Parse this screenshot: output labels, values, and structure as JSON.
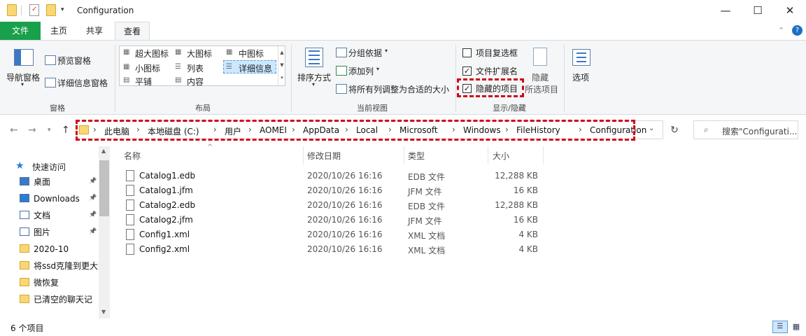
{
  "window": {
    "title": "Configuration",
    "minimize": "—",
    "maximize": "☐",
    "close": "✕"
  },
  "tabs": {
    "file": "文件",
    "home": "主页",
    "share": "共享",
    "view": "查看"
  },
  "ribbon": {
    "panes": {
      "label": "窗格",
      "nav_pane": "导航窗格",
      "preview_pane": "预览窗格",
      "details_pane": "详细信息窗格"
    },
    "layout": {
      "label": "布局",
      "xl_icons": "超大图标",
      "large_icons": "大图标",
      "medium_icons": "中图标",
      "small_icons": "小图标",
      "list": "列表",
      "details": "详细信息",
      "tiles": "平铺",
      "content": "内容"
    },
    "current_view": {
      "label": "当前视图",
      "sort_by": "排序方式",
      "group_by": "分组依据",
      "add_columns": "添加列",
      "fit_columns": "将所有列调整为合适的大小"
    },
    "show_hide": {
      "label": "显示/隐藏",
      "item_checkboxes": "项目复选框",
      "file_extensions": "文件扩展名",
      "hidden_items": "隐藏的项目",
      "hide_selected": "隐藏",
      "hide_selected_2": "所选项目",
      "hidden_items_checked": true,
      "file_extensions_checked": true,
      "item_checkboxes_checked": false
    },
    "options": "选项"
  },
  "breadcrumb": [
    "此电脑",
    "本地磁盘 (C:)",
    "用户",
    "AOMEI",
    "AppData",
    "Local",
    "Microsoft",
    "Windows",
    "FileHistory",
    "Configuration"
  ],
  "search": {
    "placeholder": "搜索\"Configurati..."
  },
  "sidebar": {
    "quick_access": "快速访问",
    "items": [
      {
        "label": "桌面",
        "pinned": true
      },
      {
        "label": "Downloads",
        "pinned": true
      },
      {
        "label": "文档",
        "pinned": true
      },
      {
        "label": "图片",
        "pinned": true
      },
      {
        "label": "2020-10",
        "pinned": false
      },
      {
        "label": "将ssd克隆到更大",
        "pinned": false
      },
      {
        "label": "微恢复",
        "pinned": false
      },
      {
        "label": "已清空的聊天记",
        "pinned": false
      }
    ]
  },
  "columns": {
    "name": "名称",
    "date": "修改日期",
    "type": "类型",
    "size": "大小"
  },
  "files": [
    {
      "name": "Catalog1.edb",
      "date": "2020/10/26 16:16",
      "type": "EDB 文件",
      "size": "12,288 KB"
    },
    {
      "name": "Catalog1.jfm",
      "date": "2020/10/26 16:16",
      "type": "JFM 文件",
      "size": "16 KB"
    },
    {
      "name": "Catalog2.edb",
      "date": "2020/10/26 16:16",
      "type": "EDB 文件",
      "size": "12,288 KB"
    },
    {
      "name": "Catalog2.jfm",
      "date": "2020/10/26 16:16",
      "type": "JFM 文件",
      "size": "16 KB"
    },
    {
      "name": "Config1.xml",
      "date": "2020/10/26 16:16",
      "type": "XML 文档",
      "size": "4 KB"
    },
    {
      "name": "Config2.xml",
      "date": "2020/10/26 16:16",
      "type": "XML 文档",
      "size": "4 KB"
    }
  ],
  "status": {
    "count": "6 个项目"
  },
  "colors": {
    "file_tab": "#19a04b",
    "highlight": "#d0021b",
    "folder": "#f8d775"
  }
}
